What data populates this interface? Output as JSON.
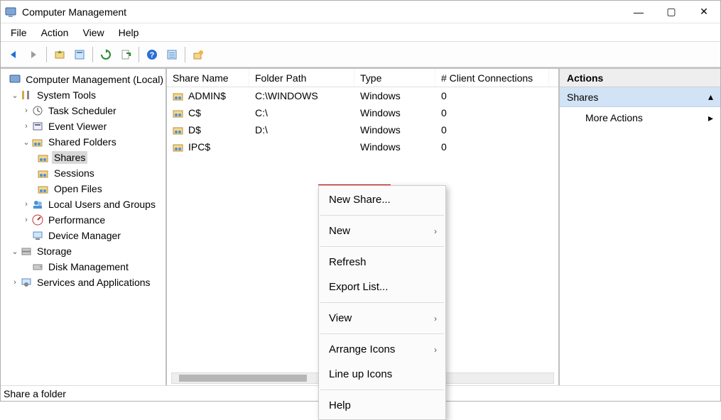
{
  "title": "Computer Management",
  "window_buttons": {
    "min": "—",
    "max": "▢",
    "close": "✕"
  },
  "menubar": [
    "File",
    "Action",
    "View",
    "Help"
  ],
  "toolbar": {
    "back": "back",
    "forward": "forward",
    "up": "up",
    "props": "props",
    "refresh": "refresh",
    "export": "export",
    "help": "help",
    "details": "details",
    "new": "new"
  },
  "tree": {
    "root": "Computer Management (Local)",
    "system_tools": "System Tools",
    "task_scheduler": "Task Scheduler",
    "event_viewer": "Event Viewer",
    "shared_folders": "Shared Folders",
    "shares": "Shares",
    "sessions": "Sessions",
    "open_files": "Open Files",
    "local_users": "Local Users and Groups",
    "performance": "Performance",
    "device_manager": "Device Manager",
    "storage": "Storage",
    "disk_management": "Disk Management",
    "services_apps": "Services and Applications"
  },
  "list": {
    "columns": {
      "name": "Share Name",
      "path": "Folder Path",
      "type": "Type",
      "conn": "# Client Connections"
    },
    "rows": [
      {
        "name": "ADMIN$",
        "path": "C:\\WINDOWS",
        "type": "Windows",
        "conn": "0"
      },
      {
        "name": "C$",
        "path": "C:\\",
        "type": "Windows",
        "conn": "0"
      },
      {
        "name": "D$",
        "path": "D:\\",
        "type": "Windows",
        "conn": "0"
      },
      {
        "name": "IPC$",
        "path": "",
        "type": "Windows",
        "conn": "0"
      }
    ]
  },
  "context_menu": {
    "new_share": "New Share...",
    "new": "New",
    "refresh": "Refresh",
    "export_list": "Export List...",
    "view": "View",
    "arrange_icons": "Arrange Icons",
    "line_up_icons": "Line up Icons",
    "help": "Help"
  },
  "actions": {
    "header": "Actions",
    "section": "Shares",
    "more": "More Actions"
  },
  "status": "Share a folder"
}
